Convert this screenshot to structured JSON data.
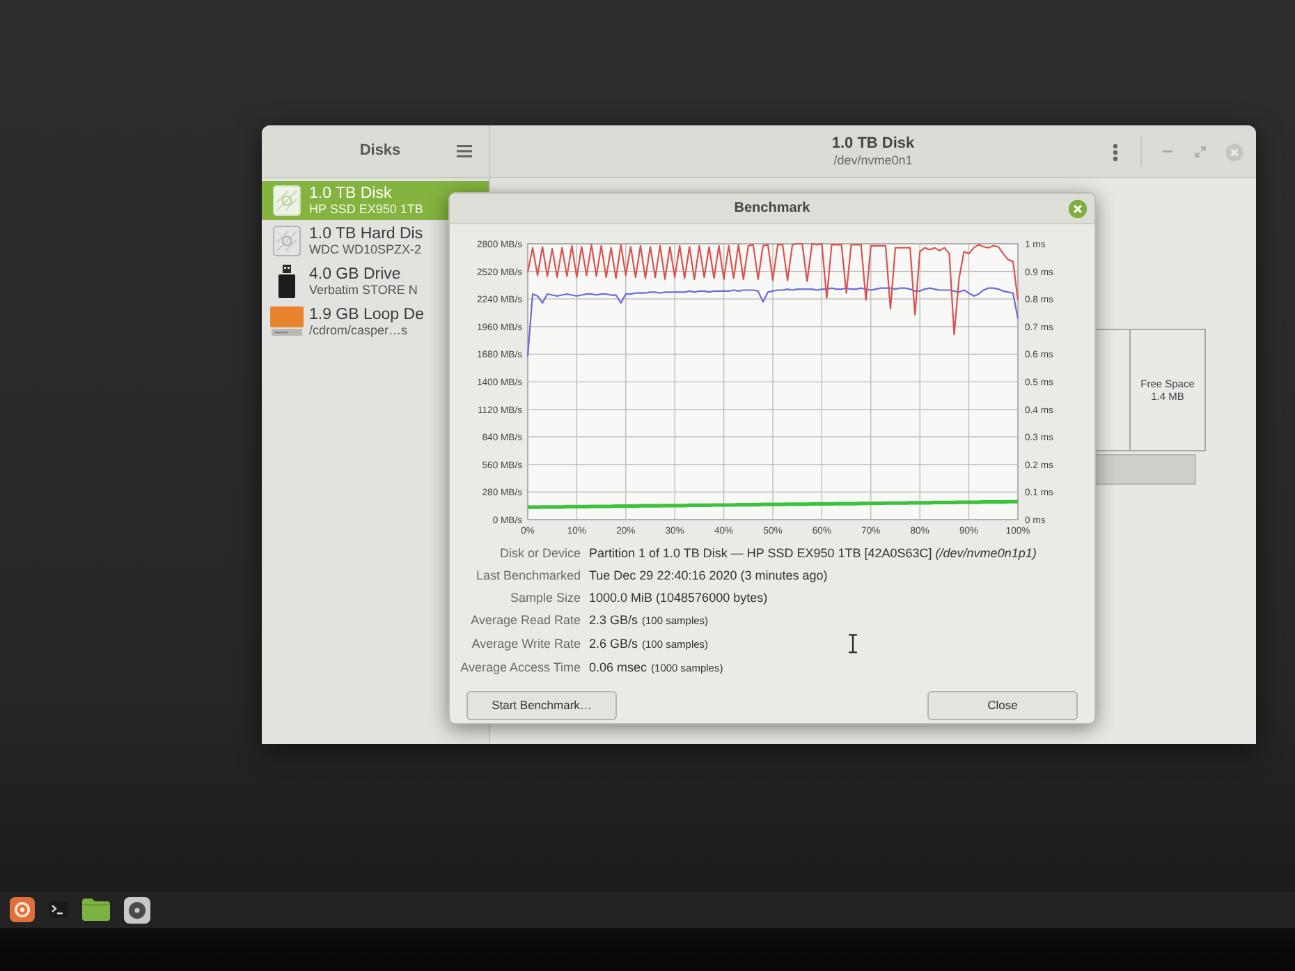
{
  "disks_window": {
    "sidebar_title": "Disks",
    "title": "1.0 TB Disk",
    "subtitle": "/dev/nvme0n1",
    "sidebar": {
      "items": [
        {
          "kind": "ssd",
          "name": "1.0 TB Disk",
          "detail": "HP SSD EX950 1TB",
          "selected": true
        },
        {
          "kind": "hdd",
          "name": "1.0 TB Hard Dis",
          "detail": "WDC WD10SPZX-2",
          "selected": false
        },
        {
          "kind": "usb",
          "name": "4.0 GB Drive",
          "detail": "Verbatim STORE N",
          "selected": false
        },
        {
          "kind": "loop",
          "name": "1.9 GB Loop De",
          "detail": "/cdrom/casper…s",
          "selected": false
        }
      ]
    },
    "free_space": {
      "label": "Free Space",
      "size": "1.4 MB"
    }
  },
  "benchmark_dialog": {
    "title": "Benchmark",
    "chart_data": {
      "type": "line",
      "grid": true,
      "x": [
        0,
        1,
        2,
        3,
        4,
        5,
        6,
        7,
        8,
        9,
        10,
        11,
        12,
        13,
        14,
        15,
        16,
        17,
        18,
        19,
        20,
        21,
        22,
        23,
        24,
        25,
        26,
        27,
        28,
        29,
        30,
        31,
        32,
        33,
        34,
        35,
        36,
        37,
        38,
        39,
        40,
        41,
        42,
        43,
        44,
        45,
        46,
        47,
        48,
        49,
        50,
        51,
        52,
        53,
        54,
        55,
        56,
        57,
        58,
        59,
        60,
        61,
        62,
        63,
        64,
        65,
        66,
        67,
        68,
        69,
        70,
        71,
        72,
        73,
        74,
        75,
        76,
        77,
        78,
        79,
        80,
        81,
        82,
        83,
        84,
        85,
        86,
        87,
        88,
        89,
        90,
        91,
        92,
        93,
        94,
        95,
        96,
        97,
        98,
        99,
        100
      ],
      "xlim": [
        0,
        100
      ],
      "xticks": [
        {
          "value": 0,
          "label": "0%"
        },
        {
          "value": 10,
          "label": "10%"
        },
        {
          "value": 20,
          "label": "20%"
        },
        {
          "value": 30,
          "label": "30%"
        },
        {
          "value": 40,
          "label": "40%"
        },
        {
          "value": 50,
          "label": "50%"
        },
        {
          "value": 60,
          "label": "60%"
        },
        {
          "value": 70,
          "label": "70%"
        },
        {
          "value": 80,
          "label": "80%"
        },
        {
          "value": 90,
          "label": "90%"
        },
        {
          "value": 100,
          "label": "100%"
        }
      ],
      "ylim": [
        0,
        2800
      ],
      "yticks": [
        {
          "value": 0,
          "label": "0 MB/s"
        },
        {
          "value": 280,
          "label": "280 MB/s"
        },
        {
          "value": 560,
          "label": "560 MB/s"
        },
        {
          "value": 840,
          "label": "840 MB/s"
        },
        {
          "value": 1120,
          "label": "1120 MB/s"
        },
        {
          "value": 1400,
          "label": "1400 MB/s"
        },
        {
          "value": 1680,
          "label": "1680 MB/s"
        },
        {
          "value": 1960,
          "label": "1960 MB/s"
        },
        {
          "value": 2240,
          "label": "2240 MB/s"
        },
        {
          "value": 2520,
          "label": "2520 MB/s"
        },
        {
          "value": 2800,
          "label": "2800 MB/s"
        }
      ],
      "y2lim": [
        0,
        1
      ],
      "y2ticks": [
        {
          "value": 0,
          "label": "0 ms"
        },
        {
          "value": 0.1,
          "label": "0.1 ms"
        },
        {
          "value": 0.2,
          "label": "0.2 ms"
        },
        {
          "value": 0.3,
          "label": "0.3 ms"
        },
        {
          "value": 0.4,
          "label": "0.4 ms"
        },
        {
          "value": 0.5,
          "label": "0.5 ms"
        },
        {
          "value": 0.6,
          "label": "0.6 ms"
        },
        {
          "value": 0.7,
          "label": "0.7 ms"
        },
        {
          "value": 0.8,
          "label": "0.8 ms"
        },
        {
          "value": 0.9,
          "label": "0.9 ms"
        },
        {
          "value": 1,
          "label": "1 ms"
        }
      ],
      "series": [
        {
          "color": "#6b6bdc",
          "values": [
            1660,
            2290,
            2270,
            2200,
            2290,
            2280,
            2270,
            2280,
            2290,
            2280,
            2270,
            2280,
            2290,
            2290,
            2280,
            2290,
            2290,
            2280,
            2280,
            2200,
            2290,
            2290,
            2300,
            2300,
            2300,
            2310,
            2310,
            2300,
            2310,
            2310,
            2310,
            2310,
            2310,
            2320,
            2310,
            2320,
            2320,
            2310,
            2320,
            2320,
            2320,
            2320,
            2330,
            2320,
            2330,
            2330,
            2330,
            2320,
            2210,
            2310,
            2320,
            2330,
            2330,
            2340,
            2330,
            2340,
            2340,
            2340,
            2340,
            2330,
            2340,
            2340,
            2350,
            2340,
            2340,
            2350,
            2340,
            2340,
            2350,
            2340,
            2330,
            2340,
            2350,
            2350,
            2350,
            2340,
            2350,
            2350,
            2340,
            2320,
            2320,
            2340,
            2350,
            2340,
            2330,
            2330,
            2330,
            2320,
            2310,
            2330,
            2300,
            2270,
            2290,
            2330,
            2350,
            2350,
            2340,
            2320,
            2310,
            2300,
            2040
          ]
        },
        {
          "color": "#d9534f",
          "values": [
            2510,
            2760,
            2480,
            2770,
            2470,
            2750,
            2460,
            2760,
            2470,
            2780,
            2460,
            2770,
            2480,
            2790,
            2470,
            2780,
            2460,
            2760,
            2450,
            2790,
            2480,
            2770,
            2460,
            2780,
            2450,
            2770,
            2460,
            2780,
            2440,
            2770,
            2460,
            2780,
            2450,
            2770,
            2440,
            2780,
            2460,
            2770,
            2450,
            2780,
            2440,
            2780,
            2450,
            2790,
            2440,
            2780,
            2790,
            2440,
            2780,
            2790,
            2430,
            2790,
            2790,
            2430,
            2790,
            2800,
            2800,
            2420,
            2800,
            2790,
            2800,
            2250,
            2790,
            2790,
            2790,
            2300,
            2790,
            2790,
            2790,
            2230,
            2780,
            2780,
            2780,
            2780,
            2140,
            2760,
            2760,
            2760,
            2760,
            2080,
            2720,
            2760,
            2740,
            2760,
            2730,
            2760,
            2700,
            1880,
            2450,
            2720,
            2700,
            2760,
            2790,
            2770,
            2760,
            2780,
            2770,
            2700,
            2640,
            2620,
            2230
          ]
        },
        {
          "color": "#3cc23c",
          "axis": "y2",
          "values": [
            0.045,
            0.045,
            0.045,
            0.046,
            0.046,
            0.046,
            0.046,
            0.046,
            0.047,
            0.047,
            0.047,
            0.047,
            0.047,
            0.048,
            0.048,
            0.048,
            0.048,
            0.048,
            0.049,
            0.049,
            0.049,
            0.049,
            0.049,
            0.05,
            0.05,
            0.05,
            0.05,
            0.05,
            0.051,
            0.051,
            0.051,
            0.051,
            0.051,
            0.052,
            0.052,
            0.052,
            0.052,
            0.052,
            0.053,
            0.053,
            0.053,
            0.053,
            0.053,
            0.054,
            0.054,
            0.054,
            0.054,
            0.054,
            0.055,
            0.055,
            0.055,
            0.055,
            0.055,
            0.056,
            0.056,
            0.056,
            0.056,
            0.056,
            0.057,
            0.057,
            0.057,
            0.057,
            0.057,
            0.058,
            0.058,
            0.058,
            0.058,
            0.058,
            0.059,
            0.059,
            0.059,
            0.059,
            0.059,
            0.06,
            0.06,
            0.06,
            0.06,
            0.06,
            0.061,
            0.061,
            0.061,
            0.061,
            0.061,
            0.062,
            0.062,
            0.062,
            0.062,
            0.062,
            0.063,
            0.063,
            0.063,
            0.063,
            0.063,
            0.064,
            0.064,
            0.064,
            0.064,
            0.064,
            0.065,
            0.065,
            0.065
          ]
        }
      ]
    },
    "details": [
      {
        "label": "Disk or Device",
        "value": "Partition 1 of 1.0 TB Disk — HP SSD EX950 1TB [42A0S63C] *(/dev/nvme0n1p1)*"
      },
      {
        "label": "Last Benchmarked",
        "value": "Tue Dec 29 22:40:16 2020 (3 minutes ago)"
      },
      {
        "label": "Sample Size",
        "value": "1000.0 MiB (1048576000 bytes)"
      },
      {
        "label": "Average Read Rate",
        "value": "2.3 GB/s",
        "note": "(100 samples)"
      },
      {
        "label": "Average Write Rate",
        "value": "2.6 GB/s",
        "note": "(100 samples)"
      },
      {
        "label": "Average Access Time",
        "value": "0.06 msec",
        "note": "(1000 samples)"
      }
    ],
    "buttons": [
      "Start Benchmark…",
      "Close"
    ]
  }
}
